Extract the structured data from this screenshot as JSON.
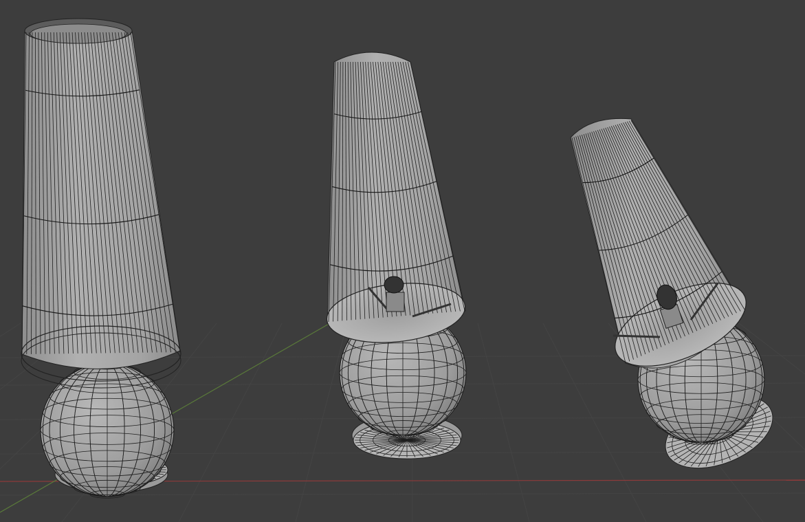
{
  "viewport": {
    "kind": "3d-viewport-wireframe-overlay",
    "background_color": "#3d3d3d",
    "grid_color": "#444444",
    "x_axis_color": "#8c3a3a",
    "y_axis_color": "#5a7a3a",
    "mesh_color": "#a7a7a7",
    "mesh_shade_color": "#8a8a8a",
    "wire_color": "#1e1e1e",
    "objects": [
      {
        "name": "lamp-upright",
        "parts": [
          "lamp-shade",
          "lamp-sphere-base",
          "lamp-foot"
        ]
      },
      {
        "name": "lamp-tilted",
        "parts": [
          "lamp-shade",
          "lamp-socket",
          "lamp-sphere-base",
          "lamp-foot"
        ]
      },
      {
        "name": "lamp-tilted-right",
        "parts": [
          "lamp-shade",
          "lamp-socket",
          "lamp-sphere-base",
          "lamp-foot"
        ]
      }
    ]
  }
}
